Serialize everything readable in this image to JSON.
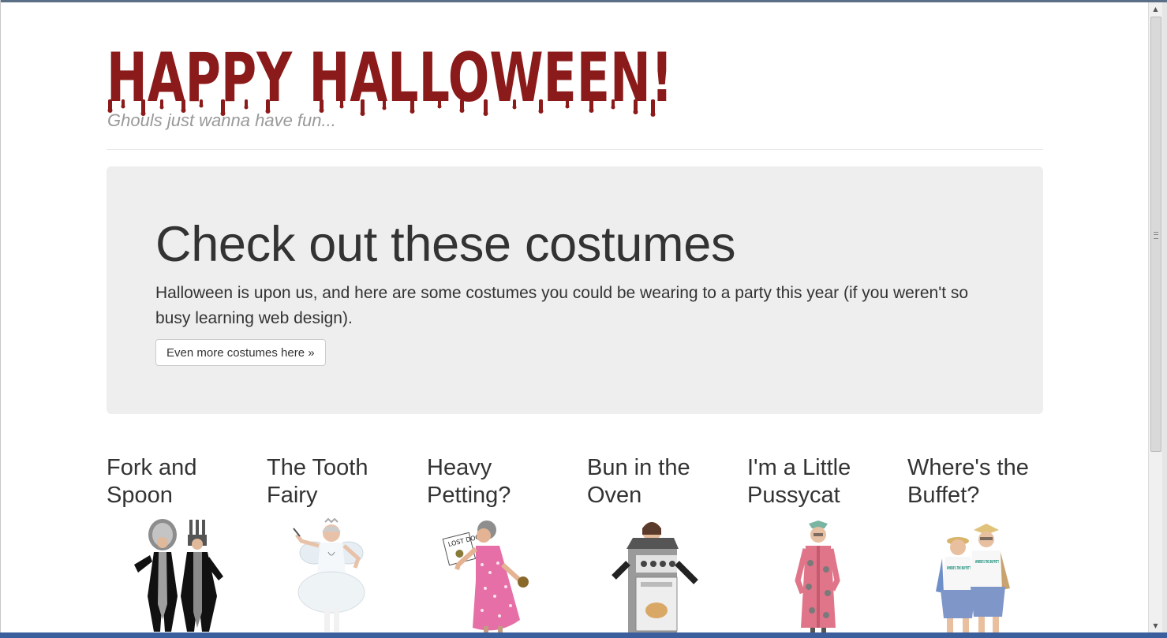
{
  "header": {
    "logo_text": "HAPPY HALLOWEEN!",
    "tagline": "Ghouls just wanna have fun..."
  },
  "jumbotron": {
    "heading": "Check out these costumes",
    "text": "Halloween is upon us, and here are some costumes you could be wearing to a party this year (if you weren't so busy learning web design).",
    "button_label": "Even more costumes here »"
  },
  "costumes": [
    {
      "title": "Fork and Spoon"
    },
    {
      "title": "The Tooth Fairy"
    },
    {
      "title": "Heavy Petting?",
      "sign_text": "LOST DOG"
    },
    {
      "title": "Bun in the Oven"
    },
    {
      "title": "I'm a Little Pussycat"
    },
    {
      "title": "Where's the Buffet?",
      "shirt_text": "WHERE'S THE BUFFET?"
    }
  ],
  "colors": {
    "logo_red": "#8b1a1a",
    "jumbotron_bg": "#eeeeee",
    "text": "#333333",
    "tagline": "#999999"
  }
}
